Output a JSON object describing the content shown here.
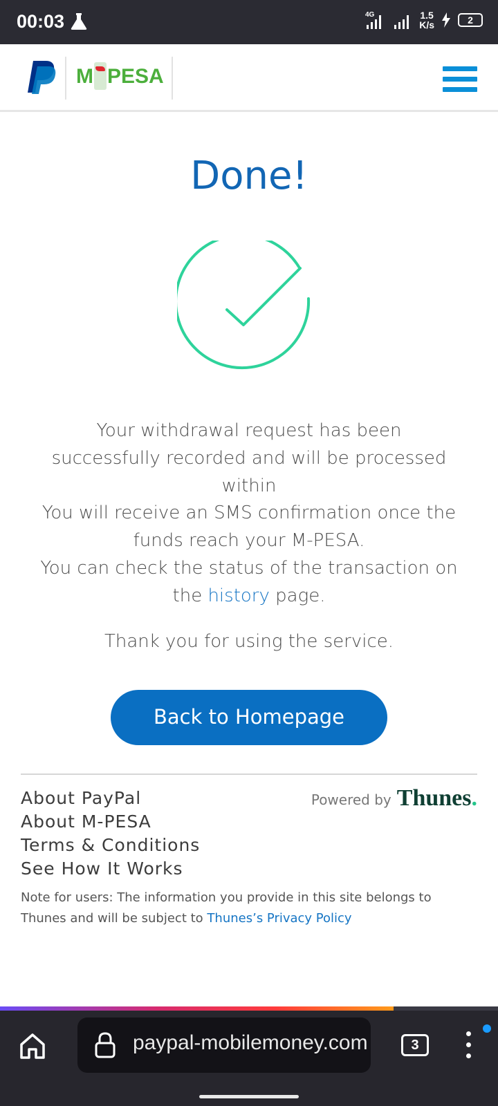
{
  "status_bar": {
    "time": "00:03",
    "network": "4G",
    "speed_value": "1.5",
    "speed_unit": "K/s",
    "battery": "2"
  },
  "header": {
    "brand1": "PayPal",
    "brand2_left": "M",
    "brand2_right": "PESA"
  },
  "main": {
    "title": "Done!",
    "msg1": "Your withdrawal request has been successfully recorded and will be processed within",
    "msg2_line1": "You will receive an SMS confirmation once the funds reach your M-PESA.",
    "msg2_line2_pre": "You can check the status of the transaction on the",
    "msg2_link": "history",
    "msg2_line2_post": "page.",
    "thanks": "Thank you for using the service.",
    "back_button": "Back to Homepage"
  },
  "footer": {
    "links": [
      "About PayPal",
      "About M-PESA",
      "Terms & Conditions",
      "See How It Works"
    ],
    "powered_by": "Powered by",
    "thunes": "Thunes",
    "thunes_dot": ".",
    "note_pre": "Note for users: The information you provide in this site belongs to Thunes and will be subject to",
    "note_link": "Thunes’s Privacy Policy"
  },
  "browser": {
    "url": "paypal-mobilemoney.com",
    "tab_count": "3",
    "load_progress": 0.79
  },
  "colors": {
    "accent": "#1266b4",
    "button": "#0a6fc2",
    "check": "#2ed39b",
    "menu": "#0a8fd8"
  }
}
